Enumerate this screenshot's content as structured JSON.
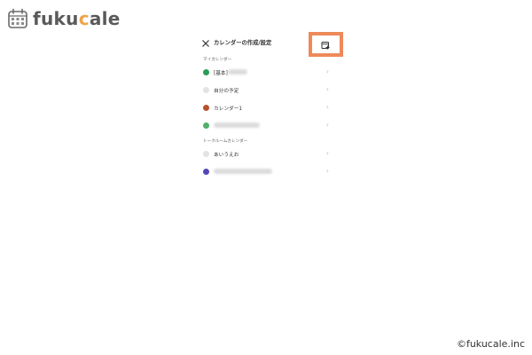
{
  "brand": {
    "name_prefix": "fuku",
    "name_accent": "c",
    "name_suffix": "ale",
    "accent_color": "#f0a34a"
  },
  "header": {
    "title": "カレンダーの作成/設定",
    "close_icon": "close-icon",
    "add_icon": "calendar-add-icon",
    "highlight_color": "#ee8a5a"
  },
  "sections": [
    {
      "label": "マイカレンダー",
      "items": [
        {
          "label": "[基本]",
          "dot_color": "#2a9d57",
          "blurred": true
        },
        {
          "label": "自分の予定",
          "dot_color": "#e3e3e3",
          "blurred": false
        },
        {
          "label": "カレンダー1",
          "dot_color": "#b5532a",
          "blurred": false
        },
        {
          "label": "",
          "dot_color": "#4fb16a",
          "blurred": true
        }
      ]
    },
    {
      "label": "トークルームカレンダー",
      "items": [
        {
          "label": "あいうえお",
          "dot_color": "#e3e3e3",
          "blurred": false
        },
        {
          "label": "",
          "dot_color": "#5347b8",
          "blurred": true
        }
      ]
    }
  ],
  "chevron": "›",
  "copyright": "©fukucale.inc"
}
